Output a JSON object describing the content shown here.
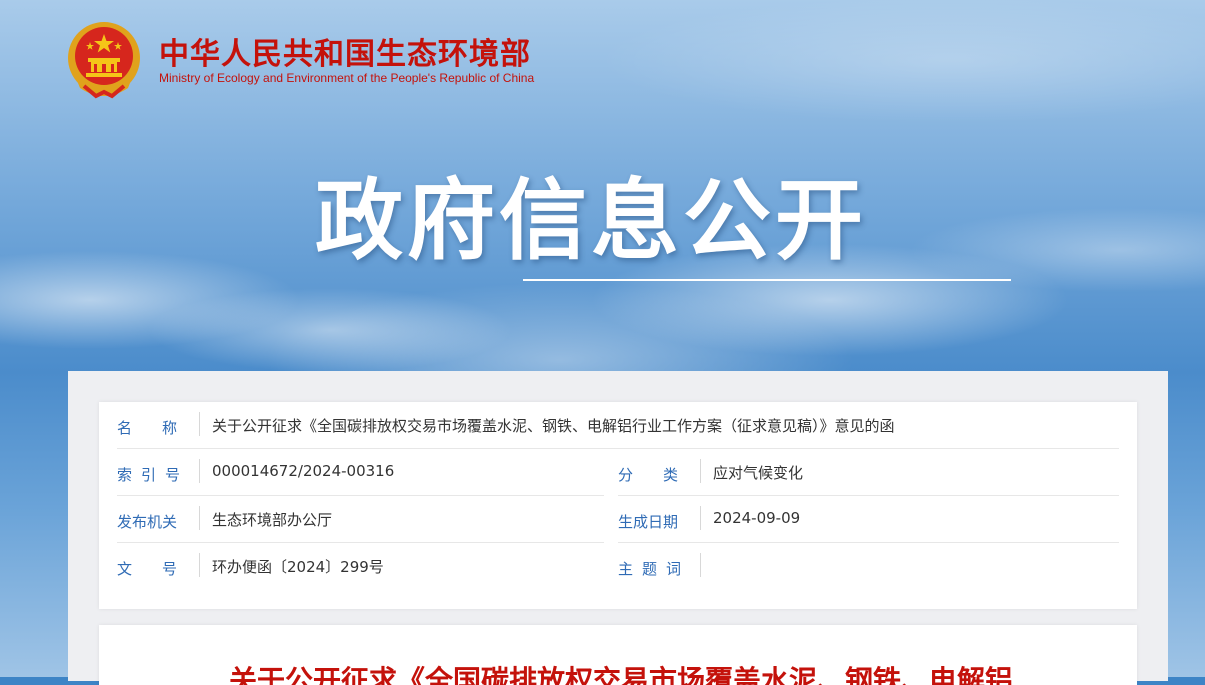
{
  "header": {
    "ministry_name_cn": "中华人民共和国生态环境部",
    "ministry_name_en": "Ministry of Ecology and Environment of the People's Republic of China",
    "emblem_icon": "national-emblem-icon"
  },
  "hero": {
    "title": "政府信息公开"
  },
  "info": {
    "name_label": "名称",
    "name_value": "关于公开征求《全国碳排放权交易市场覆盖水泥、钢铁、电解铝行业工作方案（征求意见稿）》意见的函",
    "index_label": "索引号",
    "index_value": "000014672/2024-00316",
    "category_label": "分类",
    "category_value": "应对气候变化",
    "issuer_label": "发布机关",
    "issuer_value": "生态环境部办公厅",
    "date_label": "生成日期",
    "date_value": "2024-09-09",
    "doc_no_label": "文号",
    "doc_no_value": "环办便函〔2024〕299号",
    "keywords_label": "主题词",
    "keywords_value": ""
  },
  "document": {
    "title_partial": "关于公开征求《全国碳排放权交易市场覆盖水泥、钢铁、电解铝"
  },
  "colors": {
    "brand_red": "#c4120b",
    "label_blue": "#2f6bb5",
    "sky_blue": "#4b8ccb"
  }
}
